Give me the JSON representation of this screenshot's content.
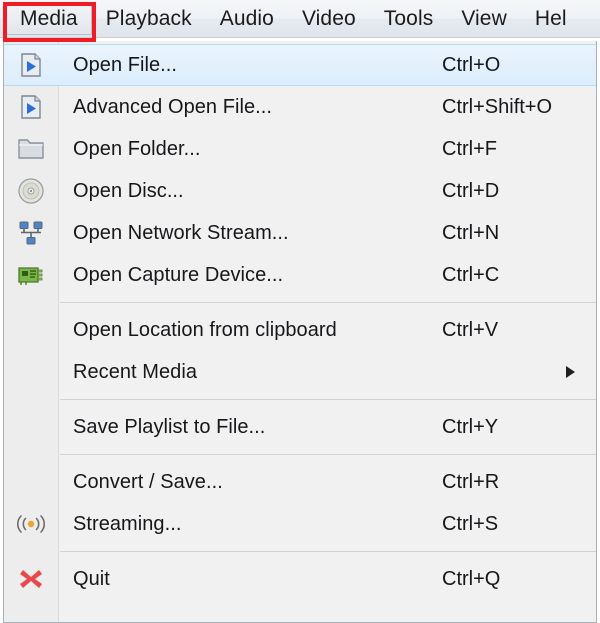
{
  "menubar": {
    "items": [
      {
        "label": "Media",
        "active": true
      },
      {
        "label": "Playback",
        "active": false
      },
      {
        "label": "Audio",
        "active": false
      },
      {
        "label": "Video",
        "active": false
      },
      {
        "label": "Tools",
        "active": false
      },
      {
        "label": "View",
        "active": false
      },
      {
        "label": "Hel",
        "active": false
      }
    ]
  },
  "highlight": {
    "target": "Media",
    "color": "#ee1c24"
  },
  "menu": {
    "groups": [
      {
        "rows": [
          {
            "label": "Open File...",
            "shortcut": "Ctrl+O",
            "icon": "open-file-icon",
            "selected": true,
            "submenu": false
          },
          {
            "label": "Advanced Open File...",
            "shortcut": "Ctrl+Shift+O",
            "icon": "advanced-open-file-icon",
            "selected": false,
            "submenu": false
          },
          {
            "label": "Open Folder...",
            "shortcut": "Ctrl+F",
            "icon": "folder-icon",
            "selected": false,
            "submenu": false
          },
          {
            "label": "Open Disc...",
            "shortcut": "Ctrl+D",
            "icon": "disc-icon",
            "selected": false,
            "submenu": false
          },
          {
            "label": "Open Network Stream...",
            "shortcut": "Ctrl+N",
            "icon": "network-icon",
            "selected": false,
            "submenu": false
          },
          {
            "label": "Open Capture Device...",
            "shortcut": "Ctrl+C",
            "icon": "capture-card-icon",
            "selected": false,
            "submenu": false
          }
        ]
      },
      {
        "rows": [
          {
            "label": "Open Location from clipboard",
            "shortcut": "Ctrl+V",
            "icon": "",
            "selected": false,
            "submenu": false
          },
          {
            "label": "Recent Media",
            "shortcut": "",
            "icon": "",
            "selected": false,
            "submenu": true
          }
        ]
      },
      {
        "rows": [
          {
            "label": "Save Playlist to File...",
            "shortcut": "Ctrl+Y",
            "icon": "",
            "selected": false,
            "submenu": false
          }
        ]
      },
      {
        "rows": [
          {
            "label": "Convert / Save...",
            "shortcut": "Ctrl+R",
            "icon": "",
            "selected": false,
            "submenu": false
          },
          {
            "label": "Streaming...",
            "shortcut": "Ctrl+S",
            "icon": "streaming-icon",
            "selected": false,
            "submenu": false
          }
        ]
      },
      {
        "rows": [
          {
            "label": "Quit",
            "shortcut": "Ctrl+Q",
            "icon": "quit-icon",
            "selected": false,
            "submenu": false
          }
        ]
      }
    ]
  },
  "colors": {
    "selection_bg": "#dcedfc",
    "panel_bg": "#f1f1f1",
    "gutter_bg": "#ededed",
    "text": "#16171a",
    "quit_red": "#e8474c",
    "streaming_orange": "#f0a330",
    "capture_green": "#7ab648",
    "play_blue": "#2b6fd6"
  }
}
